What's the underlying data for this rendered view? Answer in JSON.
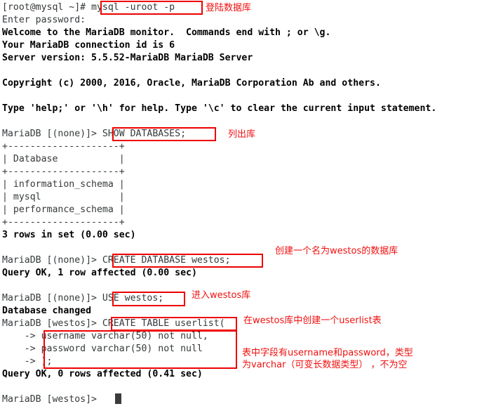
{
  "terminal": {
    "background": "#ffffff",
    "foreground": "#2b2b2b",
    "annotation_color": "#f01010",
    "cursor_color": "#3c3c3c",
    "lines": [
      {
        "id": "l01",
        "text": "[root@mysql ~]# mysql -uroot -p",
        "weight": "regular"
      },
      {
        "id": "l02",
        "text": "Enter password:",
        "weight": "regular"
      },
      {
        "id": "l03",
        "text": "Welcome to the MariaDB monitor.  Commands end with ; or \\g.",
        "weight": "bold"
      },
      {
        "id": "l04",
        "text": "Your MariaDB connection id is 6",
        "weight": "bold"
      },
      {
        "id": "l05",
        "text": "Server version: 5.5.52-MariaDB MariaDB Server",
        "weight": "bold"
      },
      {
        "id": "l06",
        "text": "",
        "weight": "regular"
      },
      {
        "id": "l07",
        "text": "Copyright (c) 2000, 2016, Oracle, MariaDB Corporation Ab and others.",
        "weight": "bold"
      },
      {
        "id": "l08",
        "text": "",
        "weight": "regular"
      },
      {
        "id": "l09",
        "text": "Type 'help;' or '\\h' for help. Type '\\c' to clear the current input statement.",
        "weight": "bold"
      },
      {
        "id": "l10",
        "text": "",
        "weight": "regular"
      },
      {
        "id": "l11",
        "text": "MariaDB [(none)]> SHOW DATABASES;",
        "weight": "regular"
      },
      {
        "id": "l12",
        "text": "+--------------------+",
        "weight": "regular"
      },
      {
        "id": "l13",
        "text": "| Database           |",
        "weight": "regular"
      },
      {
        "id": "l14",
        "text": "+--------------------+",
        "weight": "regular"
      },
      {
        "id": "l15",
        "text": "| information_schema |",
        "weight": "regular"
      },
      {
        "id": "l16",
        "text": "| mysql              |",
        "weight": "regular"
      },
      {
        "id": "l17",
        "text": "| performance_schema |",
        "weight": "regular"
      },
      {
        "id": "l18",
        "text": "+--------------------+",
        "weight": "regular"
      },
      {
        "id": "l19",
        "text": "3 rows in set (0.00 sec)",
        "weight": "bold"
      },
      {
        "id": "l20",
        "text": "",
        "weight": "regular"
      },
      {
        "id": "l21",
        "text": "MariaDB [(none)]> CREATE DATABASE westos;",
        "weight": "regular"
      },
      {
        "id": "l22",
        "text": "Query OK, 1 row affected (0.00 sec)",
        "weight": "bold"
      },
      {
        "id": "l23",
        "text": "",
        "weight": "regular"
      },
      {
        "id": "l24",
        "text": "MariaDB [(none)]> USE westos;",
        "weight": "regular"
      },
      {
        "id": "l25",
        "text": "Database changed",
        "weight": "bold"
      },
      {
        "id": "l26",
        "text": "MariaDB [westos]> CREATE TABLE userlist(",
        "weight": "regular"
      },
      {
        "id": "l27",
        "text": "    -> username varchar(50) not null,",
        "weight": "regular"
      },
      {
        "id": "l28",
        "text": "    -> password varchar(50) not null",
        "weight": "regular"
      },
      {
        "id": "l29",
        "text": "    -> );",
        "weight": "regular"
      },
      {
        "id": "l30",
        "text": "Query OK, 0 rows affected (0.41 sec)",
        "weight": "bold"
      },
      {
        "id": "l31",
        "text": "",
        "weight": "regular"
      },
      {
        "id": "l32",
        "text": "MariaDB [westos]> ",
        "weight": "regular"
      }
    ]
  },
  "highlights": [
    {
      "id": "hl-login-cmd",
      "label": "mysql -uroot -p"
    },
    {
      "id": "hl-show-databases",
      "label": "SHOW DATABASES;"
    },
    {
      "id": "hl-create-database",
      "label": "CREATE DATABASE westos;"
    },
    {
      "id": "hl-use-westos",
      "label": "USE westos;"
    },
    {
      "id": "hl-create-table",
      "label": "CREATE TABLE userlist("
    },
    {
      "id": "hl-table-columns",
      "label": "username varchar(50) not null, password varchar(50) not null );"
    }
  ],
  "annotations": {
    "login": "登陆数据库",
    "list_databases": "列出库",
    "create_database": "创建一个名为westos的数据库",
    "use_database": "进入westos库",
    "create_table": "在westos库中创建一个userlist表",
    "columns_line1": "表中字段有username和password，类型",
    "columns_line2": "为varchar（可变长数据类型） ，不为空"
  }
}
